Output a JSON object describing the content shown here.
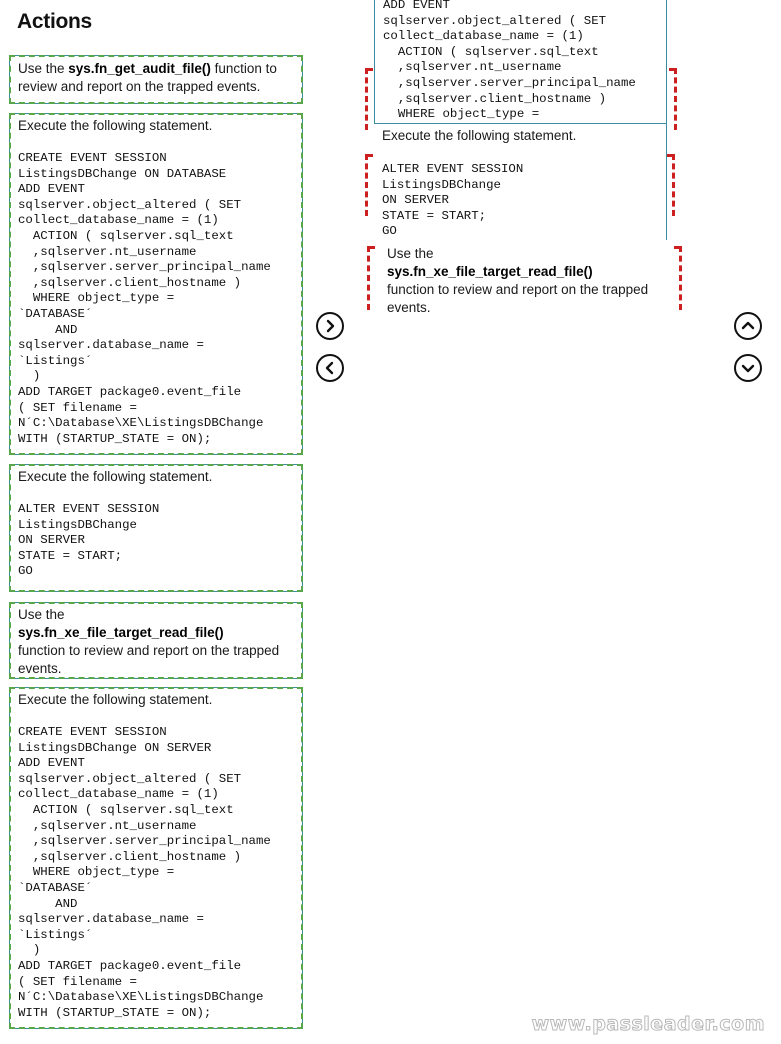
{
  "header": {
    "title": "Actions"
  },
  "actions": [
    {
      "type": "text",
      "pre": "Use the ",
      "bold": "sys.fn_get_audit_file()",
      "post": " function to review and report on the trapped events."
    },
    {
      "type": "code",
      "intro": "Execute the following statement.",
      "code": "CREATE EVENT SESSION\nListingsDBChange ON DATABASE\nADD EVENT\nsqlserver.object_altered ( SET\ncollect_database_name = (1)\n  ACTION ( sqlserver.sql_text\n  ,sqlserver.nt_username\n  ,sqlserver.server_principal_name\n  ,sqlserver.client_hostname )\n  WHERE object_type =\n`DATABASE´\n     AND\nsqlserver.database_name =\n`Listings´\n  )\nADD TARGET package0.event_file\n( SET filename =\nN´C:\\Database\\XE\\ListingsDBChange\nWITH (STARTUP_STATE = ON);"
    },
    {
      "type": "code",
      "intro": "Execute the following statement.",
      "code": "ALTER EVENT SESSION\nListingsDBChange\nON SERVER\nSTATE = START;\nGO"
    },
    {
      "type": "text-block",
      "pre": "Use the",
      "bold": "sys.fn_xe_file_target_read_file()",
      "post": "function to review and report on the trapped events."
    },
    {
      "type": "code",
      "intro": "Execute the following statement.",
      "code": "CREATE EVENT SESSION\nListingsDBChange ON SERVER\nADD EVENT\nsqlserver.object_altered ( SET\ncollect_database_name = (1)\n  ACTION ( sqlserver.sql_text\n  ,sqlserver.nt_username\n  ,sqlserver.server_principal_name\n  ,sqlserver.client_hostname )\n  WHERE object_type =\n`DATABASE´\n     AND\nsqlserver.database_name =\n`Listings´\n  )\nADD TARGET package0.event_file\n( SET filename =\nN´C:\\Database\\XE\\ListingsDBChange\nWITH (STARTUP_STATE = ON);"
    }
  ],
  "answer_area": {
    "slot1_visible_code": "ADD EVENT\nsqlserver.object_altered ( SET\ncollect_database_name = (1)\n  ACTION ( sqlserver.sql_text\n  ,sqlserver.nt_username\n  ,sqlserver.server_principal_name\n  ,sqlserver.client_hostname )\n  WHERE object_type =",
    "slot2_intro": "Execute the following statement.",
    "slot2_code": "ALTER EVENT SESSION\nListingsDBChange\nON SERVER\nSTATE = START;\nGO",
    "slot3_pre": "Use the",
    "slot3_bold": "sys.fn_xe_file_target_read_file()",
    "slot3_post": "function to review and report on the trapped events."
  },
  "controls": {
    "move_right": "move-right",
    "move_left": "move-left",
    "move_up": "move-up",
    "move_down": "move-down"
  },
  "colors": {
    "card_border": "#3a8ea0",
    "card_dash": "#5aa64a",
    "slot_dash": "#cc1f1f"
  },
  "watermark": "www.passleader.com"
}
